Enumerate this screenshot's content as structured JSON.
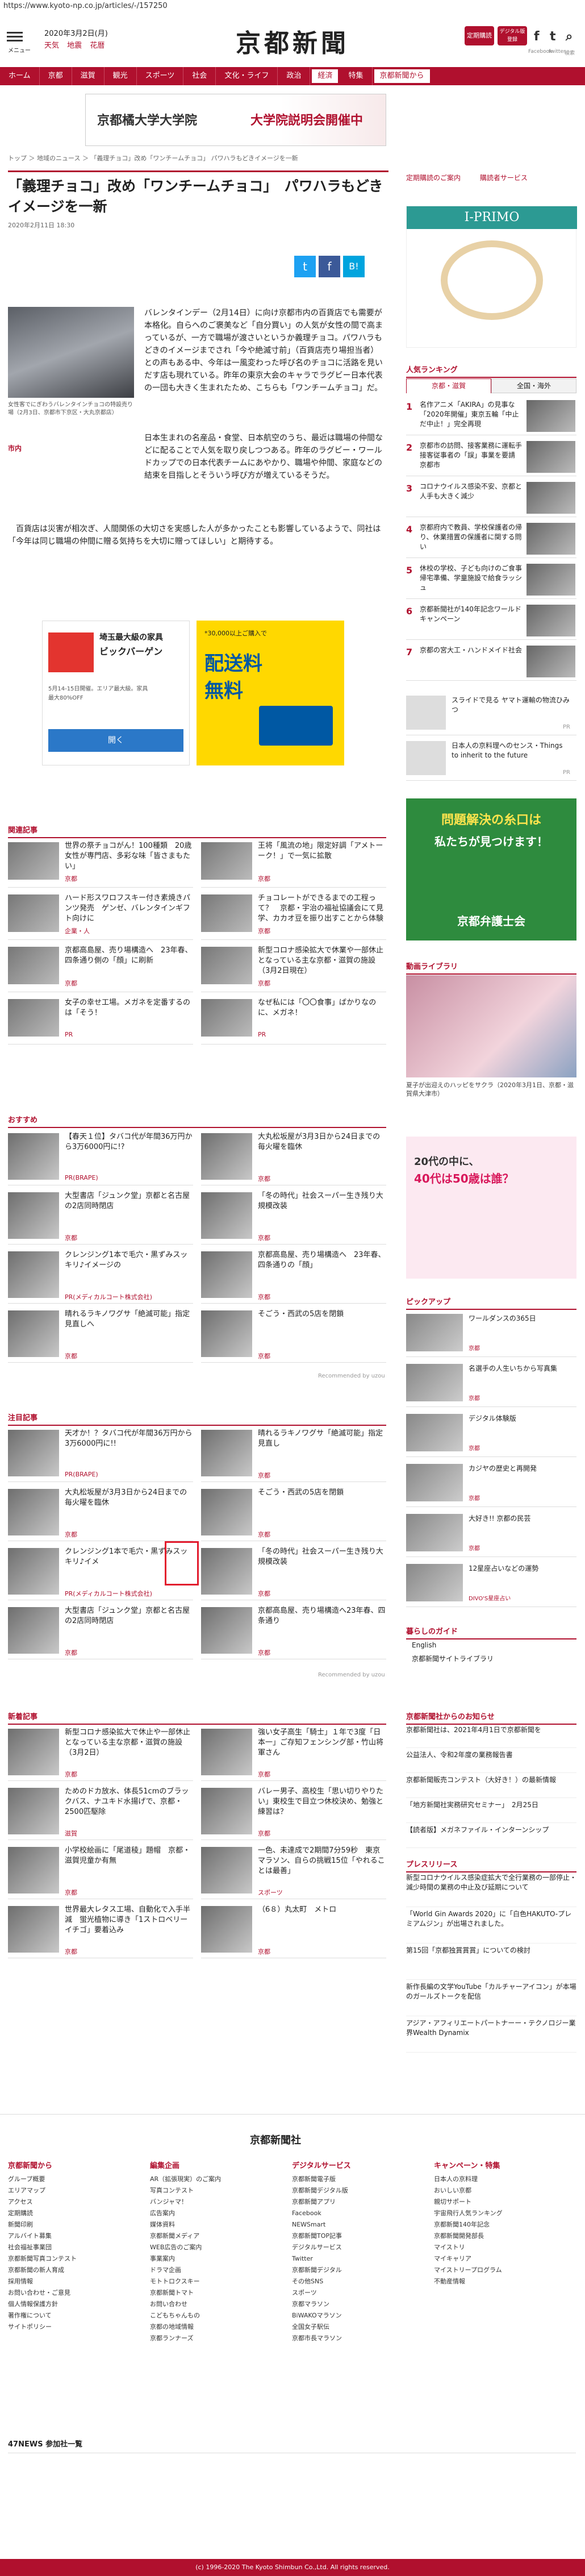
{
  "url": "https://www.kyoto-np.co.jp/articles/-/157250",
  "header": {
    "menu_label": "メニュー",
    "date": "2020年3月2日(月)",
    "weather": [
      "天気",
      "地震",
      "花暦"
    ],
    "logo": "京都新聞",
    "btn_subscribe": "定期購読",
    "btn_digital": "デジタル版登録",
    "sns": [
      {
        "glyph": "f",
        "label": "Facebook"
      },
      {
        "glyph": "t",
        "label": "twitter"
      },
      {
        "glyph": "⌕",
        "label": "検索"
      }
    ]
  },
  "nav": [
    "ホーム",
    "京都",
    "滋賀",
    "観光",
    "スポーツ",
    "社会",
    "文化・ライフ",
    "政治",
    "経済",
    "特集",
    "京都新聞から"
  ],
  "top_banner": {
    "brand": "京都橘大学大学院",
    "text": "大学院説明会開催中"
  },
  "breadcrumb": "トップ ＞ 地域のニュース ＞ 「義理チョコ」改め「ワンチームチョコ」 パワハラもどきイメージを一新",
  "side_links": [
    "定期購読のご案内",
    "購読者サービス"
  ],
  "article": {
    "title": "「義理チョコ」改め「ワンチームチョコ」　パワハラもどきイメージを一新",
    "date": "2020年2月11日 18:30",
    "share": [
      "t",
      "f",
      "B!"
    ],
    "photo_caption": "女性客でにぎわうバレンタインチョコの特設売り場（2月3日、京都市下京区・大丸京都店）",
    "section_label": "市内",
    "body1": "バレンタインデー（2月14日）に向け京都市内の百貨店でも需要が本格化。自らへのご褒美など「自分買い」の人気が女性の間で高まっているが、一方で職場が渡さいというか義理チョコ。パワハラもどきのイメージまでされ「今や絶滅寸前」（百貨店売り場担当者）との声もある中、今年は一風変わった呼び名のチョコに活路を見いだす店も現れている。昨年の東京大会のキャラでラグビー日本代表の一団も大きく生まれたため、こちらも「ワンチームチョコ」だ。",
    "body2": "日本生まれの名産品・食堂、日本航空のうち、最近は職場の仲間などに配ることで人気を取り戻しつつある。昨年のラグビー・ワールドカップでの日本代表チームにあやかり、職場や仲間、家庭などの結束を目指しとそういう呼び方が増えているそうだ。",
    "body3": "　百貨店は災害が相次ぎ、人間関係の大切さを実感した人が多かったことも影響しているようで、同社は「今年は同じ職場の仲間に贈る気持ちを大切に贈ってほしい」と期待する。"
  },
  "ad_left": {
    "title": "ビックバーゲン",
    "lines": [
      "埼玉最大級の家具",
      "5月14-15日開催。エリア最大級。家具",
      "最大80%OFF"
    ],
    "cta": "開く"
  },
  "ad_right": {
    "headline": "配送料",
    "big": "無料",
    "note": "*30,000以上ご購入で"
  },
  "related_header": "関連記事",
  "related": [
    {
      "title": "世界の祭チョコがん！100種類　20歳女性が専門店、多彩な味「皆さまもたい」",
      "tag": "京都"
    },
    {
      "title": "王将「風流の地」限定好調「アメトーーク！」で一気に拡散",
      "tag": "京都"
    },
    {
      "title": "ハード形スワロフスキー付き素焼きパンツ発売　ゲンゼ、バレンタインギフト向けに",
      "tag": "企業・人"
    },
    {
      "title": "チョコレートができるまでの工程って？　京都・宇治の福祉協議会にて見学、カカオ豆を振り出すことから体験",
      "tag": "京都"
    },
    {
      "title": "京都高島屋、売り場構造へ　23年春、四条通り側の「顔」に刷新",
      "tag": "京都"
    },
    {
      "title": "新型コロナ感染拡大で休業や一部休止となっている主な京都・滋賀の施設（3月2日現在）",
      "tag": "京都"
    },
    {
      "title": "女子の幸せ工場。メガネを定番するのは「そう！",
      "tag": "PR"
    },
    {
      "title": "なぜ私には「〇〇食事」ばかりなのに、メガネ！",
      "tag": "PR"
    }
  ],
  "related_pr": [
    "PR(株式会社アイ・アイ・シー)",
    "PR(株式会社アイ・アイ・シー)"
  ],
  "osusume_header": "おすすめ",
  "osusume": [
    {
      "title": "【春天１位】タバコ代が年間36万円から3万6000円に!?",
      "tag": "PR(BRAPE)"
    },
    {
      "title": "大丸松坂屋が3月3日から24日までの毎火曜を臨休",
      "tag": "京都"
    },
    {
      "title": "大型書店「ジュンク堂」京都と名古屋の2店同時閉店",
      "tag": "京都"
    },
    {
      "title": "「冬の時代」社会スーパー生き残り大規模改装",
      "tag": "京都"
    },
    {
      "title": "クレンジング1本で毛穴・黒ずみスッキリ♪イメージの",
      "tag": "PR(メディカルコート株式会社)"
    },
    {
      "title": "京都高島屋、売り場構造へ　23年春、四条通りの「顔」",
      "tag": "京都"
    },
    {
      "title": "晴れるラキノワグサ「絶滅可能」指定見直しへ",
      "tag": "京都"
    },
    {
      "title": "そごう・西武の5店を閉鎖",
      "tag": "京都"
    }
  ],
  "attention_header": "注目記事",
  "attention": [
    {
      "title": "天才か！？タバコ代が年間36万円から3万6000円に!!",
      "tag": "PR(BRAPE)"
    },
    {
      "title": "晴れるラキノワグサ「絶滅可能」指定見直し",
      "tag": "京都"
    },
    {
      "title": "大丸松坂屋が3月3日から24日までの毎火曜を臨休",
      "tag": "京都"
    },
    {
      "title": "そごう・西武の5店を閉鎖",
      "tag": "京都"
    },
    {
      "title": "クレンジング1本で毛穴・黒ずみスッキリ♪イメ",
      "tag": "PR(メディカルコート株式会社)"
    },
    {
      "title": "「冬の時代」社会スーパー生き残り大規模改装",
      "tag": "京都"
    },
    {
      "title": "大型書店「ジュンク堂」京都と名古屋の2店同時閉店",
      "tag": "京都"
    },
    {
      "title": "京都高島屋、売り場構造へ23年春、四条通り",
      "tag": "京都"
    }
  ],
  "recommended_by": "Recommended by uzou",
  "news_header": "新着記事",
  "news": [
    {
      "title": "新型コロナ感染拡大で休止や一部休止となっている主な京都・滋賀の施設（3月2日）",
      "tag": "京都"
    },
    {
      "title": "強い女子高生「騎士」１年で3度「日本一」ご存知フェンシング部・竹山将軍さん",
      "tag": "京都"
    },
    {
      "title": "ためのドカ放水、体長51cmのブラックバス、ナユキド水揚げで、京都・2500匹駆除",
      "tag": "滋賀"
    },
    {
      "title": "バレー男子、高校生「思い切りやりたい」東校生で目立つ休校決め、勉強と練習は？",
      "tag": "京都"
    },
    {
      "title": "小学校絵画に「尾道稜」題帽　京都・滋賀児童か有無",
      "tag": "京都"
    },
    {
      "title": "一色、未達成で2期間7分59秒　東京マラソン、自らの挑戦15位「やれることは最善」",
      "tag": "スポーツ"
    },
    {
      "title": "世界最大レタス工場、自動化で入手半減　蛍光植物に導き「1ストロベリーイチゴ」要着込み",
      "tag": "京都"
    },
    {
      "title": "（6８）丸太町　メトロ",
      "tag": "京都"
    }
  ],
  "ranking": {
    "header": "人気ランキング",
    "tabs": [
      "京都・滋賀",
      "全国・海外"
    ],
    "items": [
      {
        "rank": "1",
        "title": "名作アニメ「AKIRA」の見事な「2020年開催」東京五輪「中止だ中止！」完全再現"
      },
      {
        "rank": "2",
        "title": "京都市の訪問、接客業務に運転手接客従事者の「誤」事業を要請　京都市"
      },
      {
        "rank": "3",
        "title": "コロナウイルス感染不安、京都と人手も大きく減少"
      },
      {
        "rank": "4",
        "title": "京都府内で教員、学校保護者の帰り、休業措置の保護者に関する問い"
      },
      {
        "rank": "5",
        "title": "休校の学校、子ども向けのご食事帰宅準備、学童施設で給食ラッシュ"
      },
      {
        "rank": "6",
        "title": "京都新聞社が140年記念ワールドキャンペーン"
      },
      {
        "rank": "7",
        "title": "京都の宮大工・ハンドメイド社会"
      }
    ],
    "pr_items": [
      {
        "title": "スライドで見る ヤマト運輸の物流ひみつ",
        "tag": "PR"
      },
      {
        "title": "日本人の京料理へのセンス・Things to inherit to the future",
        "tag": "PR"
      }
    ]
  },
  "lawyer_ad": {
    "top": "問題解決の糸口は",
    "mid": "私たちが見つけます！",
    "brand": "京都弁護士会"
  },
  "video_header": "動画ライブラリ",
  "video_caption": "夏子が出迎えのハッピをサクラ（2020年3月1日、京都・滋賀県大津市）",
  "jinzai_ad": {
    "text": "20代の中に、",
    "big": "40代は50歳は誰？"
  },
  "pickup_header": "ピックアップ",
  "pickup": [
    {
      "title": "ワールダンスの365日",
      "tag": "京都"
    },
    {
      "title": "名選手の人生いちから写真集",
      "tag": "京都"
    },
    {
      "title": "デジタル体験版",
      "tag": "京都"
    },
    {
      "title": "カジヤの歴史と再開発",
      "tag": "京都"
    },
    {
      "title": "大好き!! 京都の民芸",
      "tag": "京都"
    },
    {
      "title": "12星座占いなどの運勢",
      "tag": "DIVO'S星座占い"
    }
  ],
  "guide_header": "暮らしのガイド",
  "guide": [
    "English",
    "京都新聞サイトライブラリ"
  ],
  "company_header": "京都新聞社からのお知らせ",
  "company": [
    {
      "text": "京都新聞社は、2021年4月1日で京都新聞を"
    },
    {
      "text": "公益法人、令和2年度の業務報告書"
    },
    {
      "text": "京都新聞販売コンテスト（大好き！）の最新情報"
    },
    {
      "text": "「地方新聞社実務研究セミナー」　2月25日"
    },
    {
      "text": "【読者版】メガネファイル・インターンシップ"
    }
  ],
  "press_header": "プレスリリース",
  "press": [
    {
      "text": "新型コロナウイルス感染症拡大で全行業務の一部停止・減少時間の業務の中止及び延期について"
    },
    {
      "text": "「World Gin Awards 2020」に「白色HAKUTO-プレミアムジン」が出場されました。"
    },
    {
      "text": "第15回「京都独賞賞賞」についての検討"
    },
    {
      "text": "新作長編の文学YouTube「カルチャーアイコン」が本場のガールズトークを配信"
    },
    {
      "text": "アジア・アフィリエートパートナーー・テクノロジー業界Wealth Dynamix"
    }
  ],
  "footer": {
    "brand": "京都新聞社",
    "cols": [
      {
        "header": "京都新聞から",
        "items": [
          "グループ概要",
          "エリアマップ",
          "アクセス",
          "定期購読",
          "新聞印刷",
          "アルバイト募集",
          "社会福祉事業団",
          "京都新聞写真コンテスト",
          "京都新聞の新人育成",
          "採用情報",
          "お問い合わせ・ご意見",
          "個人情報保護方針",
          "著作権について",
          "サイトポリシー"
        ]
      },
      {
        "header": "編集企画",
        "items": [
          "AR（拡張現実）のご案内",
          "写真コンテスト",
          "バンジャマ！",
          "広告案内",
          "媒体資料",
          "京都新聞メディア",
          "WEB広告のご案内",
          "事業案内",
          "ドラマ企画",
          "モトトロクスキー",
          "京都新聞トマト",
          "お問い合わせ",
          "こどもちゃんもの",
          "京都の地域情報",
          "京都ランナーズ"
        ]
      },
      {
        "header": "デジタルサービス",
        "items": [
          "京都新聞電子版",
          "京都新聞デジタル版",
          "京都新聞アプリ",
          "Facebook",
          "NEWSmart",
          "京都新聞TOP記事",
          "デジタルサービス",
          "Twitter",
          "京都新聞デジタル",
          "その他SNS",
          "スポーツ",
          "京都マラソン",
          "BiWAKOマラソン",
          "全国女子駅伝",
          "京都市長マラソン"
        ]
      },
      {
        "header": "キャンペーン・特集",
        "items": [
          "日本人の京料理",
          "おいしい京都",
          "親切サポート",
          "宇宙飛行人気ランキング",
          "京都新聞140年記念",
          "京都新聞開発部長",
          "マイストリ",
          "マイキャリア",
          "マイストリープログラム",
          "不動産情報"
        ]
      }
    ],
    "bottom_header": "47NEWS 参加社一覧",
    "copyright": "(c) 1996-2020 The Kyoto Shimbun Co.,Ltd. All rights reserved."
  },
  "colors": {
    "brand": "#b0102e",
    "green_ad": "#2e8b3e"
  }
}
